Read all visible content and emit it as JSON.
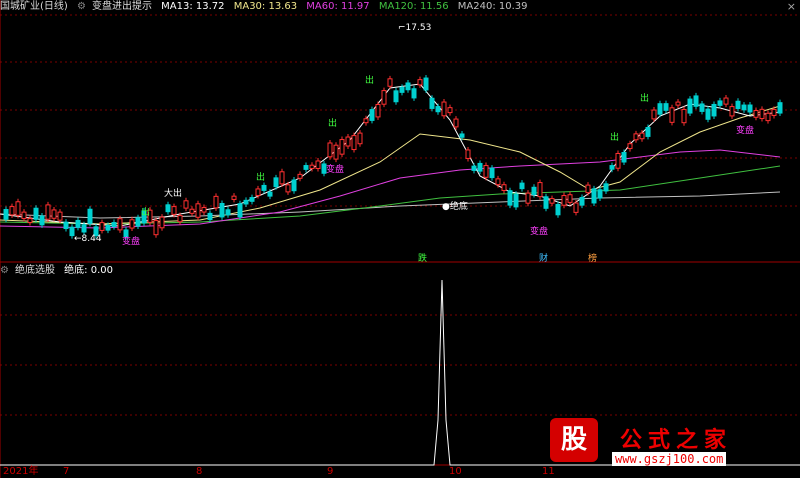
{
  "header": {
    "stock": "国城矿业(日线)",
    "indicator": "变盘进出提示",
    "ma": [
      {
        "label": "MA13: 13.72",
        "color": "#ffffff"
      },
      {
        "label": "MA30: 13.63",
        "color": "#f0e68c"
      },
      {
        "label": "MA60: 11.97",
        "color": "#e040e0"
      },
      {
        "label": "MA120: 11.56",
        "color": "#40c040"
      },
      {
        "label": "MA240: 10.39",
        "color": "#c0c0c0"
      }
    ]
  },
  "sub_header": {
    "name": "绝底选股",
    "value": "绝底: 0.00"
  },
  "price_labels": {
    "high": "17.53",
    "low": "8.44"
  },
  "markers": {
    "out": "出",
    "big_out": "大出",
    "change": "变盘",
    "bottom": "绝底",
    "fall": "跌",
    "wealth": "财",
    "bottom_tag": "榜"
  },
  "x_axis": {
    "year": "2021年",
    "months": [
      "7",
      "8",
      "9",
      "10",
      "11"
    ]
  },
  "logo": {
    "glyph": "股",
    "name": "公式之家",
    "url": "www.gszj100.com"
  },
  "chart_data": {
    "type": "candlestick",
    "ma_values": {
      "MA13": 13.72,
      "MA30": 13.63,
      "MA60": 11.97,
      "MA120": 11.56,
      "MA240": 10.39
    },
    "high": 17.53,
    "low": 8.44,
    "indicator": {
      "name": "绝底",
      "value": 0.0
    }
  }
}
